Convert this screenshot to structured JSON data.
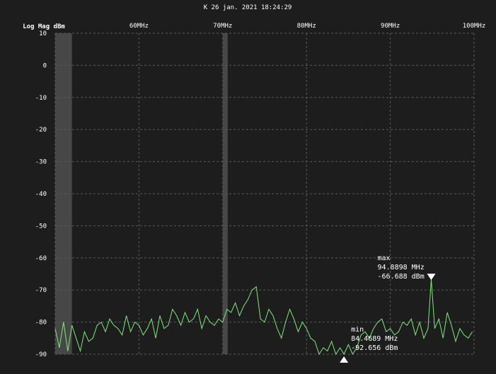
{
  "timestamp": "K 26 jan. 2021 18:24:29",
  "chart_data": {
    "type": "line",
    "ylabel": "Log Mag dBm",
    "ylim": [
      -90,
      10
    ],
    "yticks": [
      10,
      0,
      -10,
      -20,
      -30,
      -40,
      -50,
      -60,
      -70,
      -80,
      -90
    ],
    "ytick_labels": [
      "10",
      "0",
      "-10",
      "-20",
      "-30",
      "-40",
      "-50",
      "-60",
      "-70",
      "-80",
      "-90"
    ],
    "xlim_mhz": [
      50,
      100
    ],
    "xticks_mhz": [
      60,
      70,
      80,
      90,
      100
    ],
    "xtick_labels": [
      "60MHz",
      "70MHz",
      "80MHz",
      "90MHz",
      "100MHz"
    ],
    "grid": true,
    "line_color": "#7de87d",
    "band_color": "#474747",
    "shaded_bands_mhz": [
      [
        50.0,
        52.0
      ],
      [
        70.0,
        70.6
      ]
    ],
    "series": [
      {
        "x_mhz": [
          50.0,
          50.5,
          51.0,
          51.5,
          52.0,
          52.5,
          53.0,
          53.5,
          54.0,
          54.5,
          55.0,
          55.5,
          56.0,
          56.5,
          57.0,
          57.5,
          58.0,
          58.5,
          59.0,
          59.5,
          60.0,
          60.5,
          61.0,
          61.5,
          62.0,
          62.5,
          63.0,
          63.5,
          64.0,
          64.5,
          65.0,
          65.5,
          66.0,
          66.5,
          67.0,
          67.5,
          68.0,
          68.5,
          69.0,
          69.5,
          70.0,
          70.5,
          71.0,
          71.5,
          72.0,
          72.5,
          73.0,
          73.5,
          74.0,
          74.5,
          75.0,
          75.5,
          76.0,
          76.5,
          77.0,
          77.5,
          78.0,
          78.5,
          79.0,
          79.5,
          80.0,
          80.5,
          81.0,
          81.5,
          82.0,
          82.5,
          83.0,
          83.5,
          84.0,
          84.4689,
          85.0,
          85.5,
          86.0,
          86.5,
          87.0,
          87.5,
          88.0,
          88.5,
          89.0,
          89.5,
          90.0,
          90.5,
          91.0,
          91.5,
          92.0,
          92.5,
          93.0,
          93.5,
          94.0,
          94.5,
          94.8898,
          95.3,
          95.8,
          96.3,
          96.8,
          97.3,
          97.8,
          98.3,
          98.8,
          99.3,
          99.8
        ],
        "values": [
          -82,
          -88,
          -80,
          -89,
          -81,
          -85,
          -89,
          -83,
          -86,
          -85,
          -81,
          -80,
          -83,
          -79,
          -81,
          -82,
          -84,
          -78,
          -83,
          -80,
          -81,
          -84,
          -82,
          -79,
          -85,
          -78,
          -82,
          -81,
          -76,
          -78,
          -81,
          -77,
          -80,
          -79,
          -76,
          -82,
          -78,
          -80,
          -81,
          -79,
          -80,
          -76,
          -77,
          -74,
          -78,
          -75,
          -73,
          -70,
          -69,
          -79,
          -80,
          -76,
          -78,
          -82,
          -85,
          -80,
          -76,
          -79,
          -83,
          -80,
          -82,
          -85,
          -86,
          -90,
          -88,
          -89,
          -86,
          -91,
          -88,
          -92.656,
          -87,
          -90,
          -88,
          -84,
          -83,
          -85,
          -82,
          -80,
          -79,
          -83,
          -82,
          -84,
          -83,
          -80,
          -81,
          -79,
          -84,
          -80,
          -85,
          -82,
          -66.688,
          -82,
          -79,
          -85,
          -77,
          -81,
          -86,
          -82,
          -84,
          -85,
          -83
        ]
      }
    ],
    "markers": [
      {
        "name": "max",
        "freq": "94.8898 MHz",
        "level": "-66.688 dBm",
        "x_mhz": 94.8898,
        "y_dbm": -66.688,
        "pointer": "down"
      },
      {
        "name": "min",
        "freq": "84.4689 MHz",
        "level": "-92.656 dBm",
        "x_mhz": 84.4689,
        "y_dbm": -92.656,
        "pointer": "up"
      }
    ]
  }
}
